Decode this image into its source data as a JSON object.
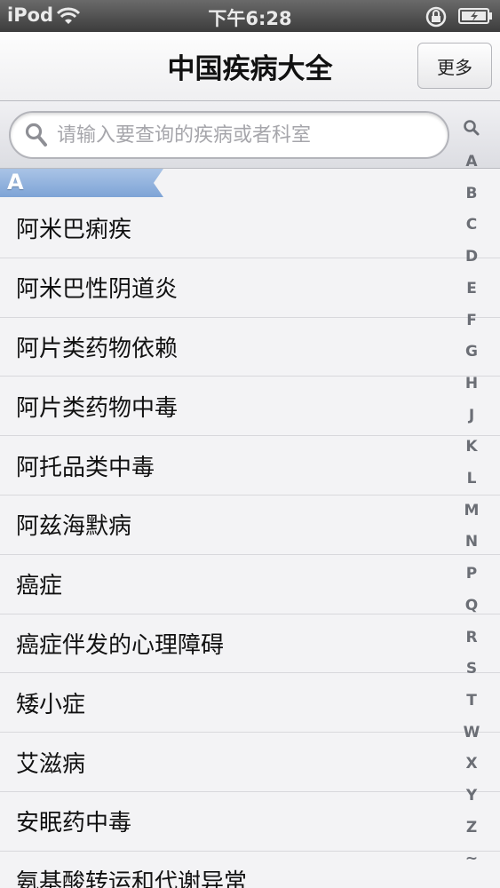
{
  "status_bar": {
    "carrier": "iPod",
    "time": "下午6:28"
  },
  "nav": {
    "title": "中国疾病大全",
    "more_button": "更多"
  },
  "search": {
    "placeholder": "请输入要查询的疾病或者科室"
  },
  "section": {
    "letter": "A"
  },
  "diseases": [
    "阿米巴痢疾",
    "阿米巴性阴道炎",
    "阿片类药物依赖",
    "阿片类药物中毒",
    "阿托品类中毒",
    "阿兹海默病",
    "癌症",
    "癌症伴发的心理障碍",
    "矮小症",
    "艾滋病",
    "安眠药中毒",
    "氨基酸转运和代谢异常"
  ],
  "index_letters": [
    "A",
    "B",
    "C",
    "D",
    "E",
    "F",
    "G",
    "H",
    "J",
    "K",
    "L",
    "M",
    "N",
    "P",
    "Q",
    "R",
    "S",
    "T",
    "W",
    "X",
    "Y",
    "Z",
    "~"
  ],
  "colors": {
    "section_tab": "#7ea4d6",
    "status_bar": "#3c3c3c"
  }
}
